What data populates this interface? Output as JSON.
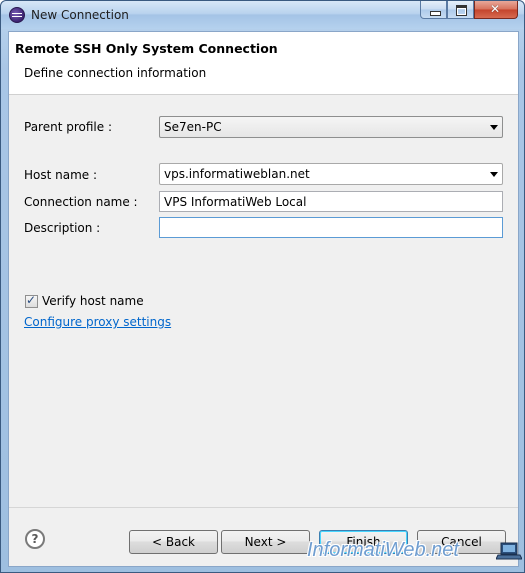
{
  "window": {
    "title": "New Connection",
    "icon": "eclipse-icon"
  },
  "header": {
    "title": "Remote SSH Only System Connection",
    "subtitle": "Define connection information"
  },
  "form": {
    "parent_profile": {
      "label": "Parent profile :",
      "value": "Se7en-PC"
    },
    "host_name": {
      "label": "Host name :",
      "value": "vps.informatiweblan.net"
    },
    "connection_name": {
      "label": "Connection name :",
      "value": "VPS InformatiWeb Local"
    },
    "description": {
      "label": "Description :",
      "value": ""
    },
    "verify_host": {
      "label": "Verify host name",
      "checked": true
    },
    "proxy_link": "Configure proxy settings"
  },
  "footer": {
    "help": "?",
    "back": "< Back",
    "next": "Next >",
    "finish": "Finish",
    "cancel": "Cancel"
  },
  "watermark": "InformatiWeb.net",
  "colors": {
    "link": "#0066cc",
    "focus_border": "#5b9bd5",
    "title_bar": "#b9d3ee"
  }
}
